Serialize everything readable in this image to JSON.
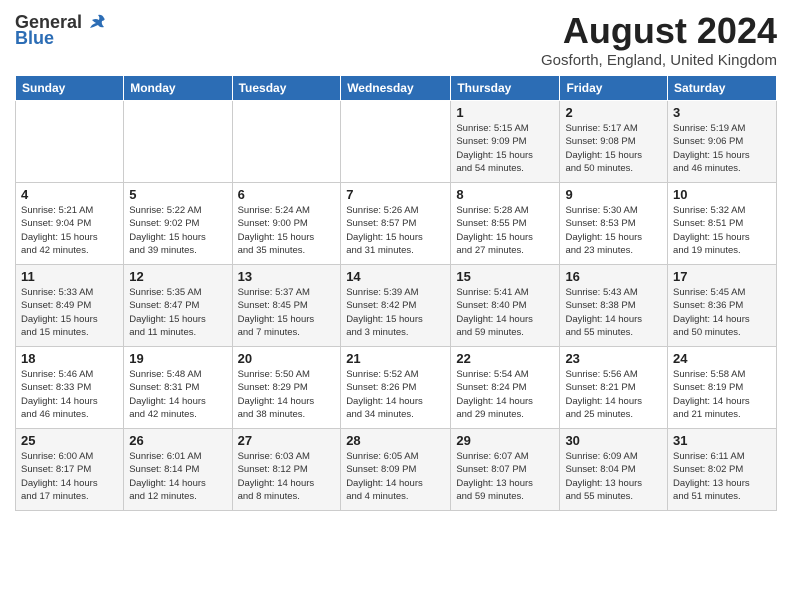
{
  "header": {
    "logo_general": "General",
    "logo_blue": "Blue",
    "month_title": "August 2024",
    "location": "Gosforth, England, United Kingdom"
  },
  "weekdays": [
    "Sunday",
    "Monday",
    "Tuesday",
    "Wednesday",
    "Thursday",
    "Friday",
    "Saturday"
  ],
  "weeks": [
    [
      {
        "day": "",
        "info": ""
      },
      {
        "day": "",
        "info": ""
      },
      {
        "day": "",
        "info": ""
      },
      {
        "day": "",
        "info": ""
      },
      {
        "day": "1",
        "info": "Sunrise: 5:15 AM\nSunset: 9:09 PM\nDaylight: 15 hours\nand 54 minutes."
      },
      {
        "day": "2",
        "info": "Sunrise: 5:17 AM\nSunset: 9:08 PM\nDaylight: 15 hours\nand 50 minutes."
      },
      {
        "day": "3",
        "info": "Sunrise: 5:19 AM\nSunset: 9:06 PM\nDaylight: 15 hours\nand 46 minutes."
      }
    ],
    [
      {
        "day": "4",
        "info": "Sunrise: 5:21 AM\nSunset: 9:04 PM\nDaylight: 15 hours\nand 42 minutes."
      },
      {
        "day": "5",
        "info": "Sunrise: 5:22 AM\nSunset: 9:02 PM\nDaylight: 15 hours\nand 39 minutes."
      },
      {
        "day": "6",
        "info": "Sunrise: 5:24 AM\nSunset: 9:00 PM\nDaylight: 15 hours\nand 35 minutes."
      },
      {
        "day": "7",
        "info": "Sunrise: 5:26 AM\nSunset: 8:57 PM\nDaylight: 15 hours\nand 31 minutes."
      },
      {
        "day": "8",
        "info": "Sunrise: 5:28 AM\nSunset: 8:55 PM\nDaylight: 15 hours\nand 27 minutes."
      },
      {
        "day": "9",
        "info": "Sunrise: 5:30 AM\nSunset: 8:53 PM\nDaylight: 15 hours\nand 23 minutes."
      },
      {
        "day": "10",
        "info": "Sunrise: 5:32 AM\nSunset: 8:51 PM\nDaylight: 15 hours\nand 19 minutes."
      }
    ],
    [
      {
        "day": "11",
        "info": "Sunrise: 5:33 AM\nSunset: 8:49 PM\nDaylight: 15 hours\nand 15 minutes."
      },
      {
        "day": "12",
        "info": "Sunrise: 5:35 AM\nSunset: 8:47 PM\nDaylight: 15 hours\nand 11 minutes."
      },
      {
        "day": "13",
        "info": "Sunrise: 5:37 AM\nSunset: 8:45 PM\nDaylight: 15 hours\nand 7 minutes."
      },
      {
        "day": "14",
        "info": "Sunrise: 5:39 AM\nSunset: 8:42 PM\nDaylight: 15 hours\nand 3 minutes."
      },
      {
        "day": "15",
        "info": "Sunrise: 5:41 AM\nSunset: 8:40 PM\nDaylight: 14 hours\nand 59 minutes."
      },
      {
        "day": "16",
        "info": "Sunrise: 5:43 AM\nSunset: 8:38 PM\nDaylight: 14 hours\nand 55 minutes."
      },
      {
        "day": "17",
        "info": "Sunrise: 5:45 AM\nSunset: 8:36 PM\nDaylight: 14 hours\nand 50 minutes."
      }
    ],
    [
      {
        "day": "18",
        "info": "Sunrise: 5:46 AM\nSunset: 8:33 PM\nDaylight: 14 hours\nand 46 minutes."
      },
      {
        "day": "19",
        "info": "Sunrise: 5:48 AM\nSunset: 8:31 PM\nDaylight: 14 hours\nand 42 minutes."
      },
      {
        "day": "20",
        "info": "Sunrise: 5:50 AM\nSunset: 8:29 PM\nDaylight: 14 hours\nand 38 minutes."
      },
      {
        "day": "21",
        "info": "Sunrise: 5:52 AM\nSunset: 8:26 PM\nDaylight: 14 hours\nand 34 minutes."
      },
      {
        "day": "22",
        "info": "Sunrise: 5:54 AM\nSunset: 8:24 PM\nDaylight: 14 hours\nand 29 minutes."
      },
      {
        "day": "23",
        "info": "Sunrise: 5:56 AM\nSunset: 8:21 PM\nDaylight: 14 hours\nand 25 minutes."
      },
      {
        "day": "24",
        "info": "Sunrise: 5:58 AM\nSunset: 8:19 PM\nDaylight: 14 hours\nand 21 minutes."
      }
    ],
    [
      {
        "day": "25",
        "info": "Sunrise: 6:00 AM\nSunset: 8:17 PM\nDaylight: 14 hours\nand 17 minutes."
      },
      {
        "day": "26",
        "info": "Sunrise: 6:01 AM\nSunset: 8:14 PM\nDaylight: 14 hours\nand 12 minutes."
      },
      {
        "day": "27",
        "info": "Sunrise: 6:03 AM\nSunset: 8:12 PM\nDaylight: 14 hours\nand 8 minutes."
      },
      {
        "day": "28",
        "info": "Sunrise: 6:05 AM\nSunset: 8:09 PM\nDaylight: 14 hours\nand 4 minutes."
      },
      {
        "day": "29",
        "info": "Sunrise: 6:07 AM\nSunset: 8:07 PM\nDaylight: 13 hours\nand 59 minutes."
      },
      {
        "day": "30",
        "info": "Sunrise: 6:09 AM\nSunset: 8:04 PM\nDaylight: 13 hours\nand 55 minutes."
      },
      {
        "day": "31",
        "info": "Sunrise: 6:11 AM\nSunset: 8:02 PM\nDaylight: 13 hours\nand 51 minutes."
      }
    ]
  ]
}
